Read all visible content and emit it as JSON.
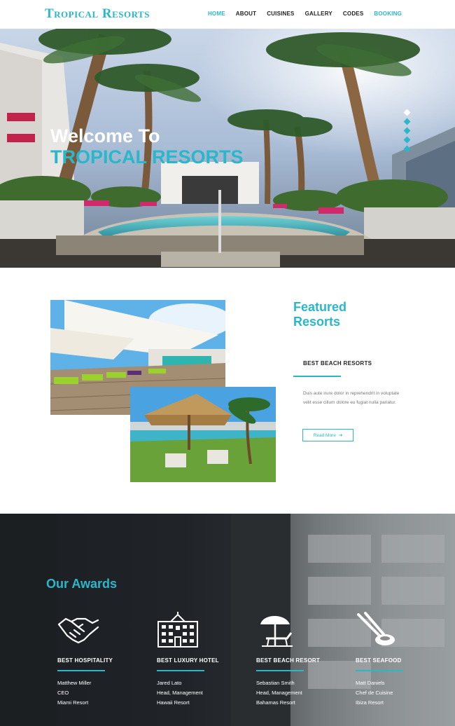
{
  "brand": {
    "logo": "Tropical Resorts",
    "accent": "#2ab7c9"
  },
  "nav": {
    "items": [
      {
        "label": "HOME",
        "active": true
      },
      {
        "label": "ABOUT"
      },
      {
        "label": "CUISINES"
      },
      {
        "label": "GALLERY"
      },
      {
        "label": "CODES"
      },
      {
        "label": "BOOKING"
      }
    ]
  },
  "hero": {
    "line1": "Welcome To",
    "line2": "TROPICAL RESORTS",
    "slides": 5,
    "active_slide": 1
  },
  "featured": {
    "title_line1": "Featured",
    "title_line2": "Resorts",
    "subtitle": "BEST BEACH RESORTS",
    "text": "Duis aute irure dolor in reprehendrit in voluptate velit esse cillum dolore eu fugiat nulla pariatur.",
    "button_label": "Read More",
    "button_icon": "arrow-right-icon"
  },
  "awards": {
    "title": "Our Awards",
    "items": [
      {
        "icon": "handshake-icon",
        "name": "BEST HOSPITALITY",
        "person": "Matthew Miller",
        "role": "CEO",
        "place": "Miami Resort"
      },
      {
        "icon": "hotel-building-icon",
        "name": "BEST LUXURY HOTEL",
        "person": "Jared Lato",
        "role": "Head, Management",
        "place": "Hawaii Resort"
      },
      {
        "icon": "beach-umbrella-icon",
        "name": "BEST BEACH RESORT",
        "person": "Sebastian Smith",
        "role": "Head, Management",
        "place": "Bahamas Resort"
      },
      {
        "icon": "sushi-chopsticks-icon",
        "name": "BEST SEAFOOD",
        "person": "Matt Daniels",
        "role": "Chef de Cuisine",
        "place": "Ibiza Resort"
      }
    ]
  }
}
